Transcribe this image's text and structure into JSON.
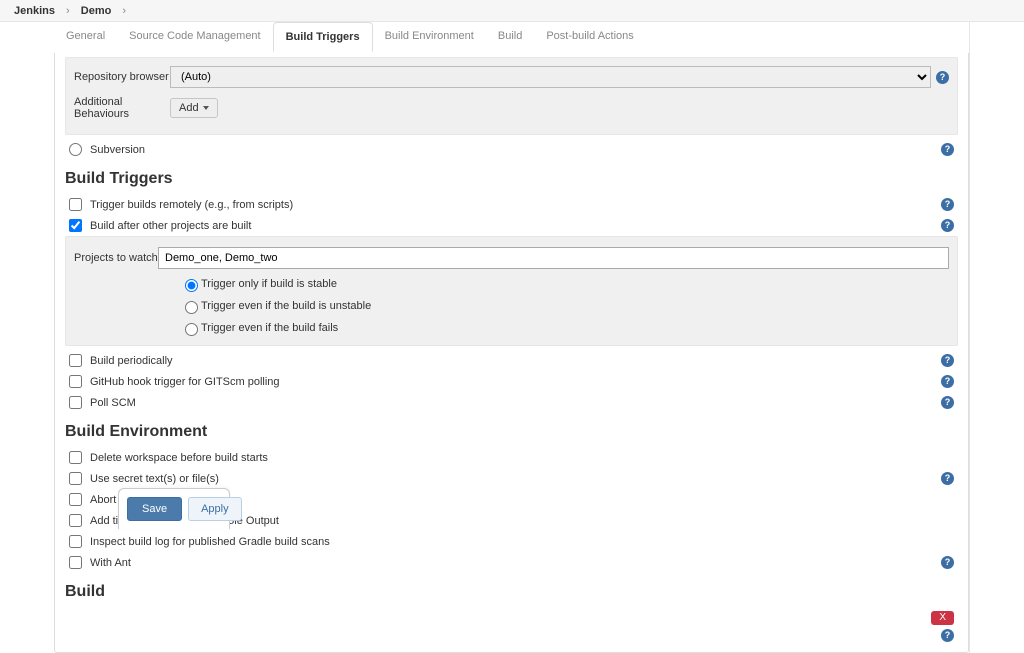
{
  "breadcrumb": [
    "Jenkins",
    "Demo"
  ],
  "tabs": [
    "General",
    "Source Code Management",
    "Build Triggers",
    "Build Environment",
    "Build",
    "Post-build Actions"
  ],
  "active_tab_index": 2,
  "scm": {
    "repo_browser_label": "Repository browser",
    "repo_browser_value": "(Auto)",
    "additional_behaviours_label": "Additional Behaviours",
    "add_button": "Add",
    "subversion_label": "Subversion"
  },
  "triggers": {
    "heading": "Build Triggers",
    "remote": {
      "label": "Trigger builds remotely (e.g., from scripts)",
      "checked": false
    },
    "after_other": {
      "label": "Build after other projects are built",
      "checked": true
    },
    "projects_label": "Projects to watch",
    "projects_value": "Demo_one, Demo_two",
    "watch_radio": {
      "stable": "Trigger only if build is stable",
      "unstable": "Trigger even if the build is unstable",
      "fail": "Trigger even if the build fails",
      "selected": "stable"
    },
    "periodic": {
      "label": "Build periodically",
      "checked": false
    },
    "gitscm": {
      "label": "GitHub hook trigger for GITScm polling",
      "checked": false
    },
    "pollscm": {
      "label": "Poll SCM",
      "checked": false
    }
  },
  "env": {
    "heading": "Build Environment",
    "delete_ws": {
      "label": "Delete workspace before build starts",
      "checked": false
    },
    "secret": {
      "label": "Use secret text(s) or file(s)",
      "checked": false
    },
    "abort_stuck": {
      "label": "Abort the build if it's stuck",
      "checked": false
    },
    "timestamps": {
      "label": "Add timestamps to the Console Output",
      "checked": false
    },
    "gradle_scan": {
      "label": "Inspect build log for published Gradle build scans",
      "checked": false
    },
    "with_ant": {
      "label": "With Ant",
      "checked": false
    }
  },
  "build": {
    "heading": "Build"
  },
  "buttons": {
    "save": "Save",
    "apply": "Apply",
    "close": "X"
  }
}
